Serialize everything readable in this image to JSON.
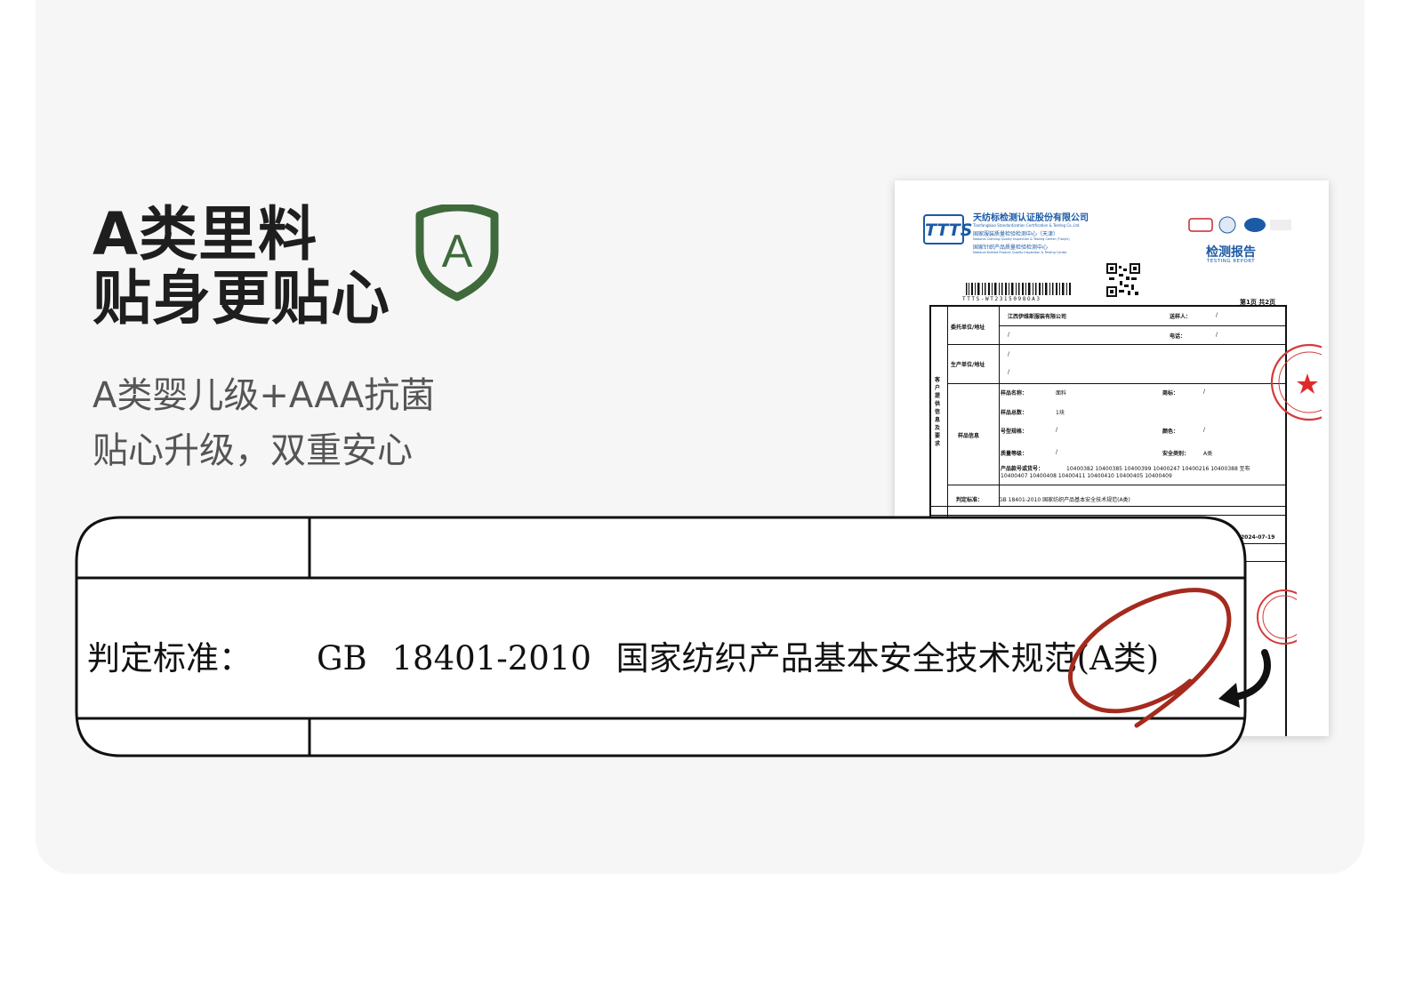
{
  "hero": {
    "title_lines": [
      "A类里料",
      "贴身更贴心"
    ],
    "subtitle_lines": [
      "A类婴儿级+AAA抗菌",
      "贴心升级，双重安心"
    ],
    "badge_icon": "shield-a-icon",
    "badge_letter": "A",
    "accent_color": "#3f6a3c"
  },
  "certificate": {
    "logo_text": "TTTS",
    "org_name": "天纺标检测认证股份有限公司",
    "org_name_en": "Tianfangbiao Standardization Certification & Testing Co.,Ltd.",
    "org_sub1": "国家服装质量检验检测中心（天津）",
    "org_sub1_en": "National Clothing Quality Inspection & Testing Center (Tianjin)",
    "org_sub2": "国家针织产品质量检验检测中心",
    "org_sub2_en": "National Knitted Product Quality Inspection & Testing Center",
    "report_title": "检测报告",
    "report_title_en": "TESTING REPORT",
    "report_no": "TTTS-WT2315098OA3",
    "page_info": "第1页 共2页",
    "table": {
      "side_label": "客户提供信息及要求",
      "client_label": "委托单位/地址",
      "client_value": "江西伊维斯服装有限公司",
      "client_addr": "/",
      "sampler_label": "送样人：",
      "sampler_value": "/",
      "phone_label": "电话：",
      "phone_value": "/",
      "producer_label": "生产单位/地址",
      "producer_value": "/",
      "producer_addr": "/",
      "sample_info_label": "样品信息",
      "sample_name_label": "样品名称：",
      "sample_name_value": "面料",
      "brand_label": "商标：",
      "brand_value": "/",
      "sample_count_label": "样品总数：",
      "sample_count_value": "1块",
      "model_label": "号型规格：",
      "model_value": "/",
      "color_label": "颜色：",
      "color_value": "/",
      "grade_label": "质量等级：",
      "grade_value": "/",
      "safety_label": "安全类别：",
      "safety_value": "A类",
      "item_no_label": "产品款号或货号：",
      "item_no_line1": "10400382  10400385  10400399  10400247  10400216  10400388  至布",
      "item_no_line2": "10400407  10400408  10400411  10400410  10400405  10400409",
      "standard_label": "判定标准：",
      "standard_value": "GB 18401-2010  国家纺织产品基本安全技术规范(A类)",
      "date_value": "2024-07-19"
    }
  },
  "zoom": {
    "label": "判定标准：",
    "value": "GB 18401-2010  国家纺织产品基本安全技术规范(A类)"
  }
}
